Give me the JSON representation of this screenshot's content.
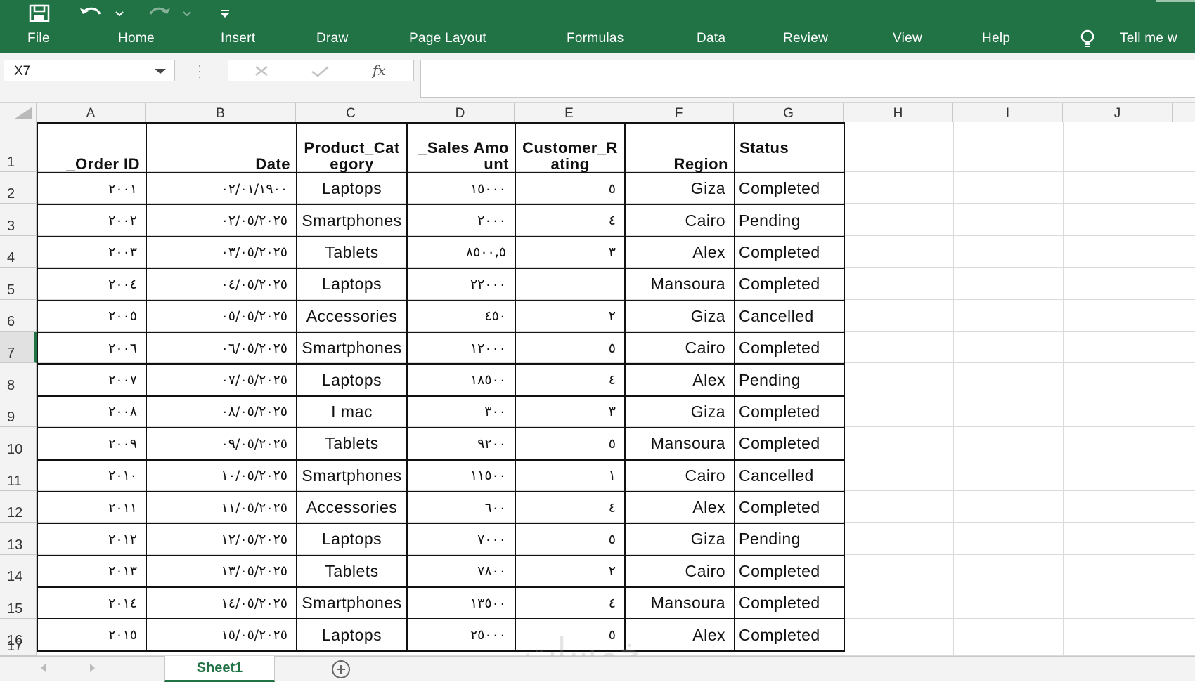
{
  "ribbon": {
    "menu": [
      "File",
      "Home",
      "Insert",
      "Draw",
      "Page Layout",
      "Formulas",
      "Data",
      "Review",
      "View",
      "Help",
      "Tell me w"
    ],
    "accent": "#217346"
  },
  "formula_bar": {
    "name_box": "X7",
    "formula": "",
    "fx_label": "fx"
  },
  "columns": [
    "A",
    "B",
    "C",
    "D",
    "E",
    "F",
    "G",
    "H",
    "I",
    "J"
  ],
  "rows": [
    "1",
    "2",
    "3",
    "4",
    "5",
    "6",
    "7",
    "8",
    "9",
    "10",
    "11",
    "12",
    "13",
    "14",
    "15",
    "16",
    "17"
  ],
  "selected_row": "7",
  "table": {
    "headers": [
      "_Order ID",
      "Date",
      "Product_Category",
      "_Sales Amount",
      "Customer_Rating",
      "Region",
      "Status"
    ],
    "rows": [
      [
        "٢٠٠١",
        "٠٢/٠١/١٩٠٠",
        "Laptops",
        "١٥٠٠٠",
        "٥",
        "Giza",
        "Completed"
      ],
      [
        "٢٠٠٢",
        "٠٢/٠٥/٢٠٢٥",
        "Smartphones",
        "٢٠٠٠",
        "٤",
        "Cairo",
        "Pending"
      ],
      [
        "٢٠٠٣",
        "٠٣/٠٥/٢٠٢٥",
        "Tablets",
        "٨٥٠٠,٥",
        "٣",
        "Alex",
        "Completed"
      ],
      [
        "٢٠٠٤",
        "٠٤/٠٥/٢٠٢٥",
        "Laptops",
        "٢٢٠٠٠",
        "",
        "Mansoura",
        "Completed"
      ],
      [
        "٢٠٠٥",
        "٠٥/٠٥/٢٠٢٥",
        "Accessories",
        "٤٥٠",
        "٢",
        "Giza",
        "Cancelled"
      ],
      [
        "٢٠٠٦",
        "٠٦/٠٥/٢٠٢٥",
        "Smartphones",
        "١٢٠٠٠",
        "٥",
        "Cairo",
        "Completed"
      ],
      [
        "٢٠٠٧",
        "٠٧/٠٥/٢٠٢٥",
        "Laptops",
        "١٨٥٠٠",
        "٤",
        "Alex",
        "Pending"
      ],
      [
        "٢٠٠٨",
        "٠٨/٠٥/٢٠٢٥",
        "I mac",
        "٣٠٠",
        "٣",
        "Giza",
        "Completed"
      ],
      [
        "٢٠٠٩",
        "٠٩/٠٥/٢٠٢٥",
        "Tablets",
        "٩٢٠٠",
        "٥",
        "Mansoura",
        "Completed"
      ],
      [
        "٢٠١٠",
        "١٠/٠٥/٢٠٢٥",
        "Smartphones",
        "١١٥٠٠",
        "١",
        "Cairo",
        "Cancelled"
      ],
      [
        "٢٠١١",
        "١١/٠٥/٢٠٢٥",
        "Accessories",
        "٦٠٠",
        "٤",
        "Alex",
        "Completed"
      ],
      [
        "٢٠١٢",
        "١٢/٠٥/٢٠٢٥",
        "Laptops",
        "٧٠٠٠",
        "٥",
        "Giza",
        "Pending"
      ],
      [
        "٢٠١٣",
        "١٣/٠٥/٢٠٢٥",
        "Tablets",
        "٧٨٠٠",
        "٢",
        "Cairo",
        "Completed"
      ],
      [
        "٢٠١٤",
        "١٤/٠٥/٢٠٢٥",
        "Smartphones",
        "١٣٥٠٠",
        "٤",
        "Mansoura",
        "Completed"
      ],
      [
        "٢٠١٥",
        "١٥/٠٥/٢٠٢٥",
        "Laptops",
        "٢٥٠٠٠",
        "٥",
        "Alex",
        "Completed"
      ]
    ]
  },
  "sheet_tabs": [
    "Sheet1"
  ],
  "watermark": "خمسات"
}
